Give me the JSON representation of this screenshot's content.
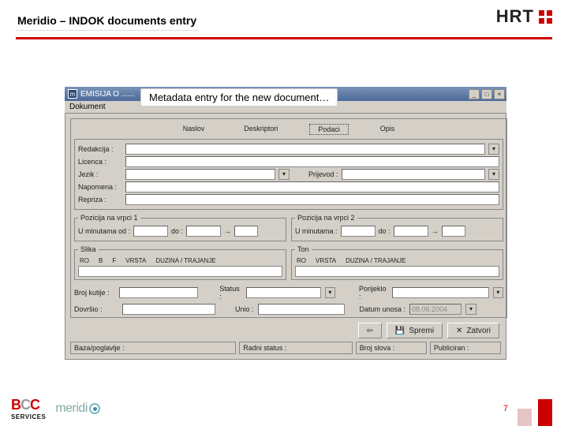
{
  "header": {
    "title": "Meridio – INDOK documents entry"
  },
  "logo": {
    "hrt": "HRT"
  },
  "annotation": "Metadata entry for the new document…",
  "window": {
    "title": "EMISIJA O ......",
    "menu": {
      "dokument": "Dokument"
    },
    "tabs": {
      "naslov": "Naslov",
      "deskriptori": "Deskriptori",
      "podaci": "Podaci",
      "opis": "Opis"
    },
    "fields": {
      "redakcija": "Redakcija :",
      "licenca": "Licenca :",
      "jezik": "Jezik :",
      "prijevod": "Prijevod :",
      "napomena": "Napomena :",
      "repriza": "Repriza :"
    },
    "pozicija1": {
      "legend": "Pozicija na vrpci 1",
      "od": "U minutama od :",
      "do": "do :"
    },
    "pozicija2": {
      "legend": "Pozicija na vrpci 2",
      "od": "U minutama :",
      "do": "do :"
    },
    "slika": {
      "legend": "Slika",
      "ro": "RO",
      "b": "B",
      "f": "F",
      "vrsta": "VRSTA",
      "duzina": "DUZINA / TRAJANJE"
    },
    "ton": {
      "legend": "Ton",
      "ro": "RO",
      "vrsta": "VRSTA",
      "duzina": "DUZINA / TRAJANJE"
    },
    "meta": {
      "broj_kutije": "Broj kutije :",
      "status": "Status :",
      "porijeklo": "Porijeklo :",
      "dovrsio": "Dovršio :",
      "unio": "Unio :",
      "datum_unosa": "Datum unosa :",
      "datum_value": "08.06.2004"
    },
    "buttons": {
      "spremi": "Spremi",
      "zatvori": "Zatvori"
    },
    "statusbar": {
      "baza": "Baza/poglavlje :",
      "radni": "Radni status :",
      "broj_slova": "Broj slova :",
      "publiciran": "Publiciran :"
    }
  },
  "footer": {
    "bcc": "BCC",
    "bcc_sub": "SERVICES",
    "meridio": "meridi",
    "page": "7"
  }
}
